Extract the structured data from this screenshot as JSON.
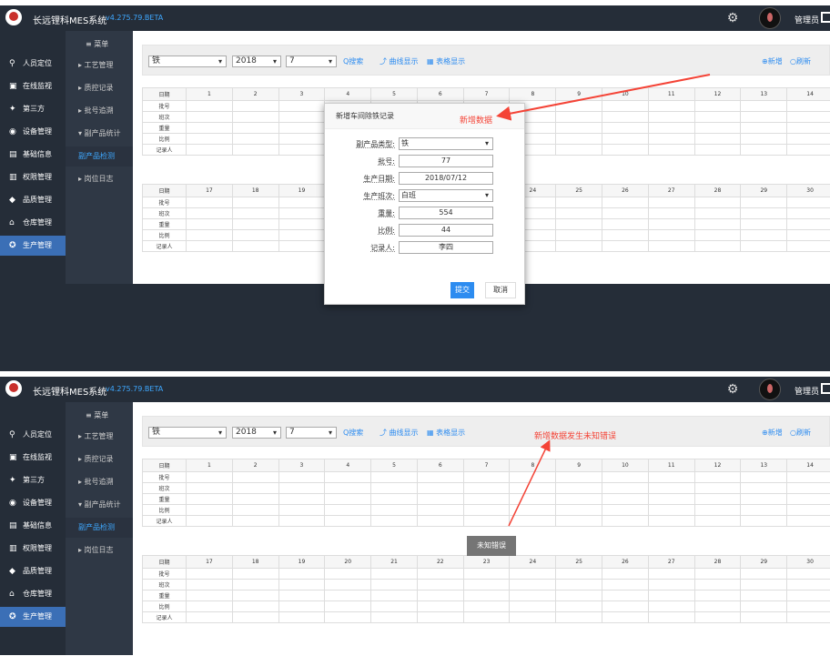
{
  "app": {
    "title": "长远锂科MES系统",
    "version": "v4.275.79.BETA",
    "username": "管理员"
  },
  "sidebar": {
    "items": [
      {
        "label": "人员定位",
        "icon": "person-pin-icon"
      },
      {
        "label": "在线监视",
        "icon": "monitor-icon"
      },
      {
        "label": "第三方",
        "icon": "handshake-icon"
      },
      {
        "label": "设备管理",
        "icon": "device-icon"
      },
      {
        "label": "基础信息",
        "icon": "info-grid-icon"
      },
      {
        "label": "权限管理",
        "icon": "lock-icon"
      },
      {
        "label": "品质管理",
        "icon": "quality-icon"
      },
      {
        "label": "仓库管理",
        "icon": "warehouse-icon"
      },
      {
        "label": "生产管理",
        "icon": "production-icon",
        "active": true
      }
    ]
  },
  "subnav": {
    "header": "≡ 菜单",
    "items": [
      {
        "label": "▸ 工艺管理"
      },
      {
        "label": "▸ 质控记录"
      },
      {
        "label": "▸ 批号追溯"
      },
      {
        "label": "▾ 副产品统计"
      },
      {
        "label": "副产品检测",
        "selected": true
      },
      {
        "label": "▸ 岗位日志"
      }
    ]
  },
  "toolbar": {
    "type": "铁",
    "year": "2018",
    "month": "7",
    "search": "Q搜索",
    "chart": "曲线显示",
    "table": "表格显示",
    "add": "新增",
    "refresh": "刷新"
  },
  "table": {
    "row_labels": [
      "日期",
      "批号",
      "班次",
      "重量",
      "比例",
      "记录人"
    ],
    "days_first": [
      "1",
      "2",
      "3",
      "4",
      "5",
      "6",
      "7",
      "8",
      "9",
      "10",
      "11",
      "12",
      "13",
      "14"
    ],
    "days_second": [
      "17",
      "18",
      "19",
      "20",
      "21",
      "22",
      "23",
      "24",
      "25",
      "26",
      "27",
      "28",
      "29",
      "30"
    ]
  },
  "dialog": {
    "title": "新增车间除铁记录",
    "fields": [
      {
        "label": "副产品类型:",
        "value": "铁",
        "kind": "select"
      },
      {
        "label": "批号:",
        "value": "77",
        "kind": "input"
      },
      {
        "label": "生产日期:",
        "value": "2018/07/12",
        "kind": "input"
      },
      {
        "label": "生产班次:",
        "value": "白班",
        "kind": "select"
      },
      {
        "label": "重量:",
        "value": "554",
        "kind": "input"
      },
      {
        "label": "比例:",
        "value": "44",
        "kind": "input"
      },
      {
        "label": "记录人:",
        "value": "李四",
        "kind": "input"
      }
    ],
    "submit": "提交",
    "cancel": "取消"
  },
  "annotations": {
    "new_data": "新增数据",
    "error_note": "新增数据发生未知错误"
  },
  "toast": "未知错误",
  "colors": {
    "topbar": "#252d38",
    "accent": "#2d8cf0",
    "annotation": "#f44336",
    "active_nav": "#3b6fb6"
  }
}
